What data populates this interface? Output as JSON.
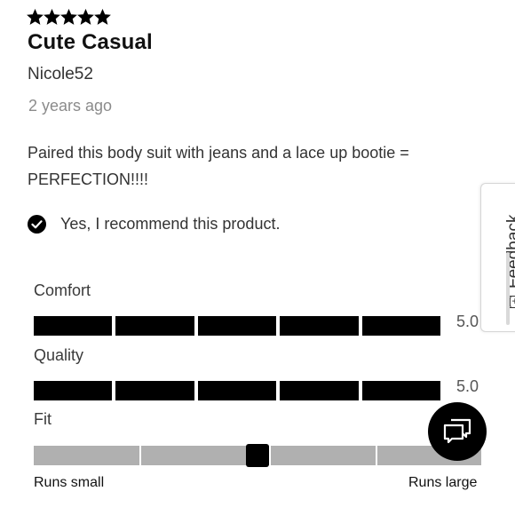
{
  "review": {
    "rating": 5,
    "rating_max": 5,
    "title": "Cute Casual",
    "author": "Nicole52",
    "date": "2 years ago",
    "body": "Paired this body suit with jeans and a lace up bootie = PERFECTION!!!!",
    "recommend_text": "Yes, I recommend this product."
  },
  "ratings": [
    {
      "label": "Comfort",
      "score_text": "5.0",
      "value": 5,
      "max": 5
    },
    {
      "label": "Quality",
      "score_text": "5.0",
      "value": 5,
      "max": 5
    }
  ],
  "fit": {
    "label": "Fit",
    "min_label": "Runs small",
    "max_label": "Runs large",
    "value_fraction": 0.5,
    "segments": 5
  },
  "feedback_tab": {
    "label": "Feedback",
    "icon": "[+]"
  },
  "icons": {
    "stars": "star-icon",
    "check": "check-circle-icon",
    "chat": "chat-bubbles-icon"
  },
  "colors": {
    "filled": "#000000",
    "empty": "#b3b3b3",
    "muted_text": "#8b8b8b"
  }
}
